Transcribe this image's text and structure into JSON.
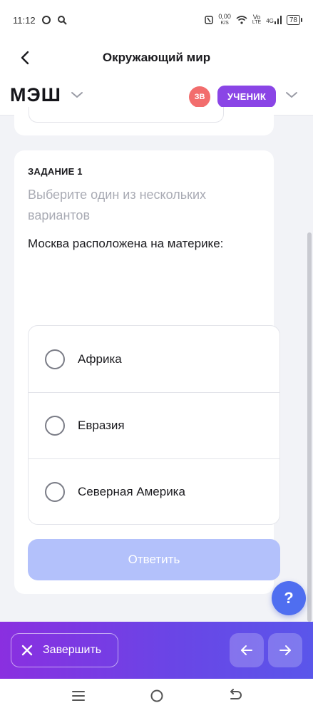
{
  "status_bar": {
    "time": "11:12",
    "net_speed_value": "0,00",
    "net_speed_unit": "K/S",
    "volte": "Vo",
    "lte": "LTE",
    "signal": "4G",
    "battery": "78"
  },
  "header": {
    "title": "Окружающий мир"
  },
  "brand": {
    "logo": "МЭШ",
    "avatar_initials": "ЗВ",
    "role": "УЧЕНИК"
  },
  "task": {
    "label": "ЗАДАНИЕ 1",
    "hint": "Выберите один из нескольких вариантов",
    "question": "Москва расположена на материке:",
    "options": [
      {
        "label": "Африка"
      },
      {
        "label": "Евразия"
      },
      {
        "label": "Северная Америка"
      }
    ],
    "submit_label": "Ответить"
  },
  "help": {
    "label": "?"
  },
  "action_bar": {
    "finish_label": "Завершить"
  },
  "colors": {
    "accent": "#8a45e6",
    "submit_disabled": "#b3c1fb",
    "help_fab": "#4f6ef0",
    "avatar": "#f26d6d"
  }
}
